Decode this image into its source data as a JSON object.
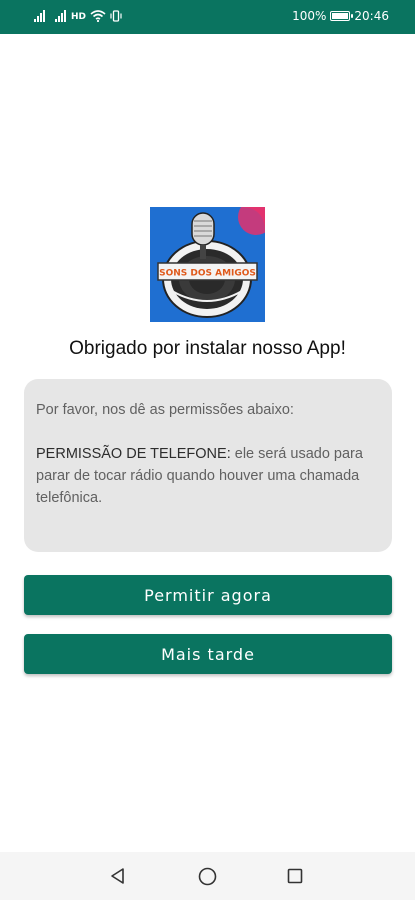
{
  "status_bar": {
    "network_type": "HD",
    "battery_percent": "100%",
    "time": "20:46"
  },
  "logo": {
    "text": "SONS DOS AMIGOS",
    "colors": {
      "bg": "#1f6fd1",
      "accent": "#e2336f",
      "banner": "#f4f4f4",
      "banner_text": "#e05a1c"
    }
  },
  "title": "Obrigado por instalar nosso App!",
  "permissions": {
    "intro": "Por favor, nos dê as permissões abaixo:",
    "phone_label": "PERMISSÃO DE TELEFONE:",
    "phone_desc": " ele será usado para parar de tocar rádio quando houver uma chamada telefônica."
  },
  "buttons": {
    "allow": "Permitir agora",
    "later": "Mais tarde"
  },
  "nav_icons": [
    "back-icon",
    "home-icon",
    "recent-apps-icon"
  ],
  "colors": {
    "primary": "#0a7460",
    "box_bg": "#e6e6e6"
  }
}
